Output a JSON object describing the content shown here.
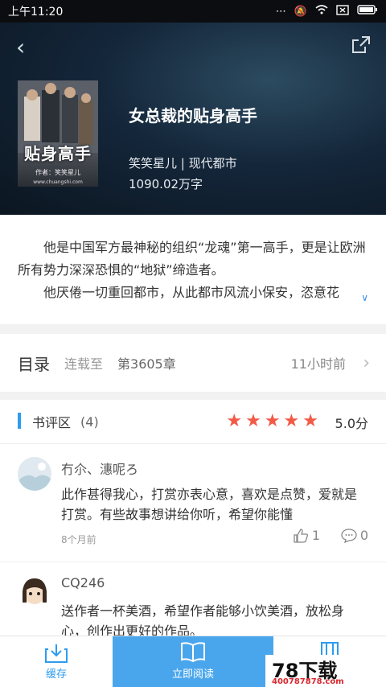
{
  "status_bar": {
    "time": "上午11:20"
  },
  "book": {
    "title": "女总裁的贴身高手",
    "author_genre": "笑笑星儿 | 现代都市",
    "word_count": "1090.02万字",
    "cover": {
      "title": "贴身高手",
      "small_title": "女总裁的",
      "author": "作者：笑笑星儿",
      "site": "www.chuangshi.com"
    }
  },
  "intro": {
    "line1": "他是中国军方最神秘的组织“龙魂”第一高手，更是让欧洲所有势力深深恐惧的“地狱”缔造者。",
    "line2": "他厌倦一切重回都市，从此都市风流小保安，恣意花"
  },
  "catalog": {
    "title": "目录",
    "serial": "连载至",
    "chapter": "第3605章",
    "updated": "11小时前"
  },
  "reviews": {
    "label": "书评区",
    "count": "(4)",
    "stars": "★★★★★",
    "score": "5.0分",
    "items": [
      {
        "name": "冇尒、潓呢ろ",
        "text": "此作甚得我心，打赏亦表心意，喜欢是点赞，爱就是打赏。有些故事想讲给你听，希望你能懂",
        "date": "8个月前",
        "likes": "1",
        "comments": "0"
      },
      {
        "name": "CQ246",
        "text": "送作者一杯美酒，希望作者能够小饮美酒，放松身心，创作出更好的作品。"
      }
    ]
  },
  "bottom_bar": {
    "cache": "缓存",
    "read": "立即阅读",
    "shelf": ""
  },
  "watermark": {
    "brand": "78下载",
    "url": "400787878.com"
  }
}
